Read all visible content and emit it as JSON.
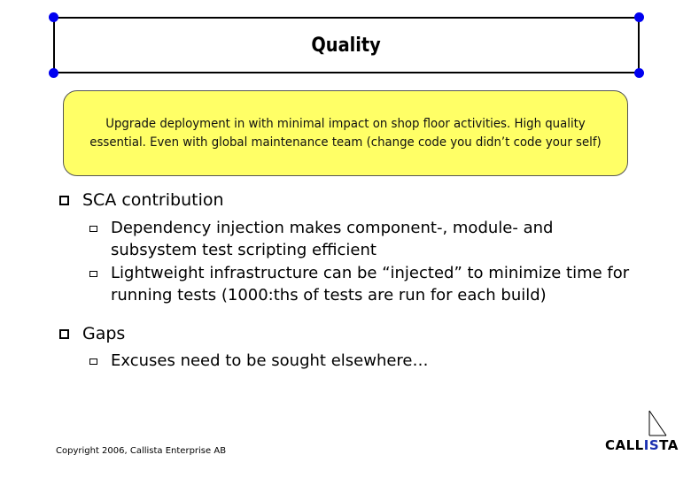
{
  "slide": {
    "title": "Quality",
    "callout": "Upgrade deployment in with minimal impact on shop floor activities. High quality essential. Even with global maintenance team (change code you didn’t code your self)",
    "sections": [
      {
        "heading": "SCA contribution",
        "items": [
          "Dependency injection makes component-, module- and subsystem test scripting efficient",
          "Lightweight infrastructure can be “injected” to minimize time for running tests (1000:ths of tests are run for each build)"
        ]
      },
      {
        "heading": "Gaps",
        "items": [
          "Excuses need to be sought elsewhere…"
        ]
      }
    ],
    "footer": {
      "copyright": "Copyright 2006, Callista Enterprise AB",
      "logo": {
        "part1": "CALL",
        "part2": "IS",
        "part3": "TA"
      }
    },
    "colors": {
      "handle": "#0000f0",
      "callout_bg": "#ffff66",
      "logo_accent": "#1a2fb0"
    }
  }
}
